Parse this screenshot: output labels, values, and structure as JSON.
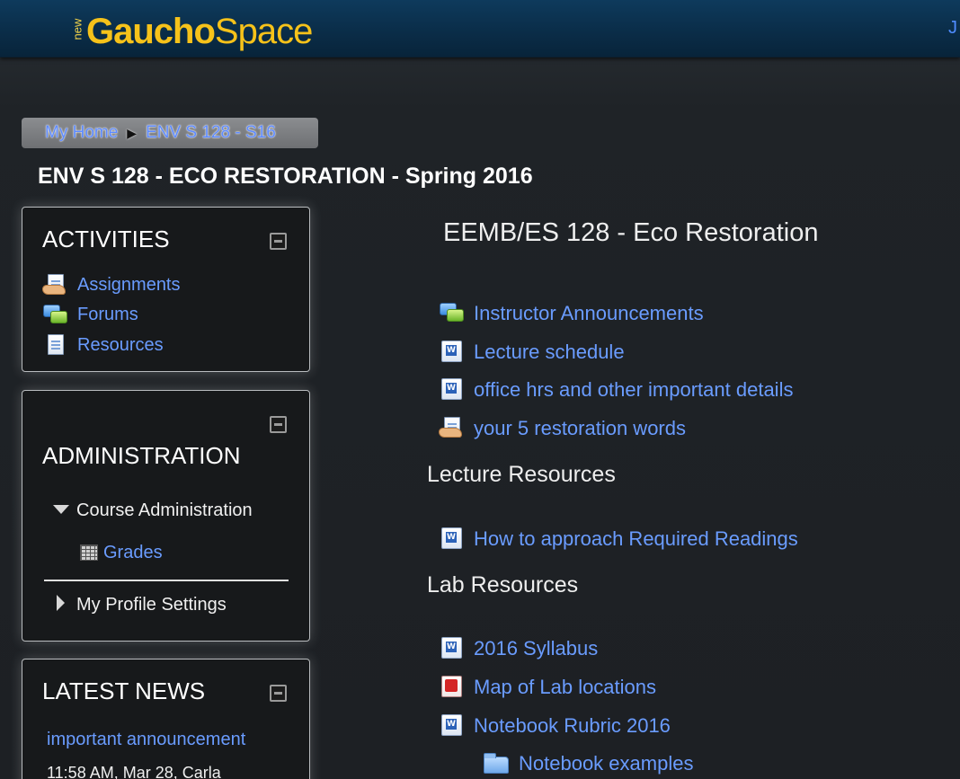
{
  "header": {
    "logo_new": "new",
    "logo_gaucho": "Gaucho",
    "logo_space": "Space",
    "user_link": "J"
  },
  "breadcrumb": {
    "items": [
      "My Home",
      "ENV S 128 - S16"
    ],
    "separator": "▶"
  },
  "page_title": "ENV S 128 - ECO RESTORATION - Spring 2016",
  "activities": {
    "title": "ACTIVITIES",
    "items": [
      {
        "label": "Assignments",
        "icon": "assignment-icon"
      },
      {
        "label": "Forums",
        "icon": "forum-icon"
      },
      {
        "label": "Resources",
        "icon": "resource-icon"
      }
    ]
  },
  "administration": {
    "title": "ADMINISTRATION",
    "course_admin": "Course Administration",
    "grades": "Grades",
    "profile_settings": "My Profile Settings"
  },
  "latest_news": {
    "title": "LATEST NEWS",
    "item_link": "important announcement",
    "item_meta": "11:58 AM, Mar 28, Carla"
  },
  "main": {
    "course_heading": "EEMB/ES 128 - Eco Restoration",
    "top_items": [
      {
        "label": "Instructor Announcements",
        "icon": "forum-icon"
      },
      {
        "label": "Lecture schedule",
        "icon": "word-doc-icon"
      },
      {
        "label": "office hrs and other important details",
        "icon": "word-doc-icon"
      },
      {
        "label": "your 5 restoration words",
        "icon": "assignment-icon"
      }
    ],
    "lecture_resources": {
      "title": "Lecture Resources",
      "items": [
        {
          "label": "How to approach Required Readings",
          "icon": "word-doc-icon"
        }
      ]
    },
    "lab_resources": {
      "title": "Lab Resources",
      "items": [
        {
          "label": "2016 Syllabus",
          "icon": "word-doc-icon"
        },
        {
          "label": "Map of Lab locations",
          "icon": "pdf-icon"
        },
        {
          "label": "Notebook Rubric 2016",
          "icon": "word-doc-icon"
        },
        {
          "label": "Notebook examples",
          "icon": "folder-icon"
        }
      ]
    }
  },
  "colors": {
    "link": "#6a9cff",
    "header_bg": "#0a2c47",
    "logo": "#f6c21a",
    "page_bg": "#1f2327"
  }
}
